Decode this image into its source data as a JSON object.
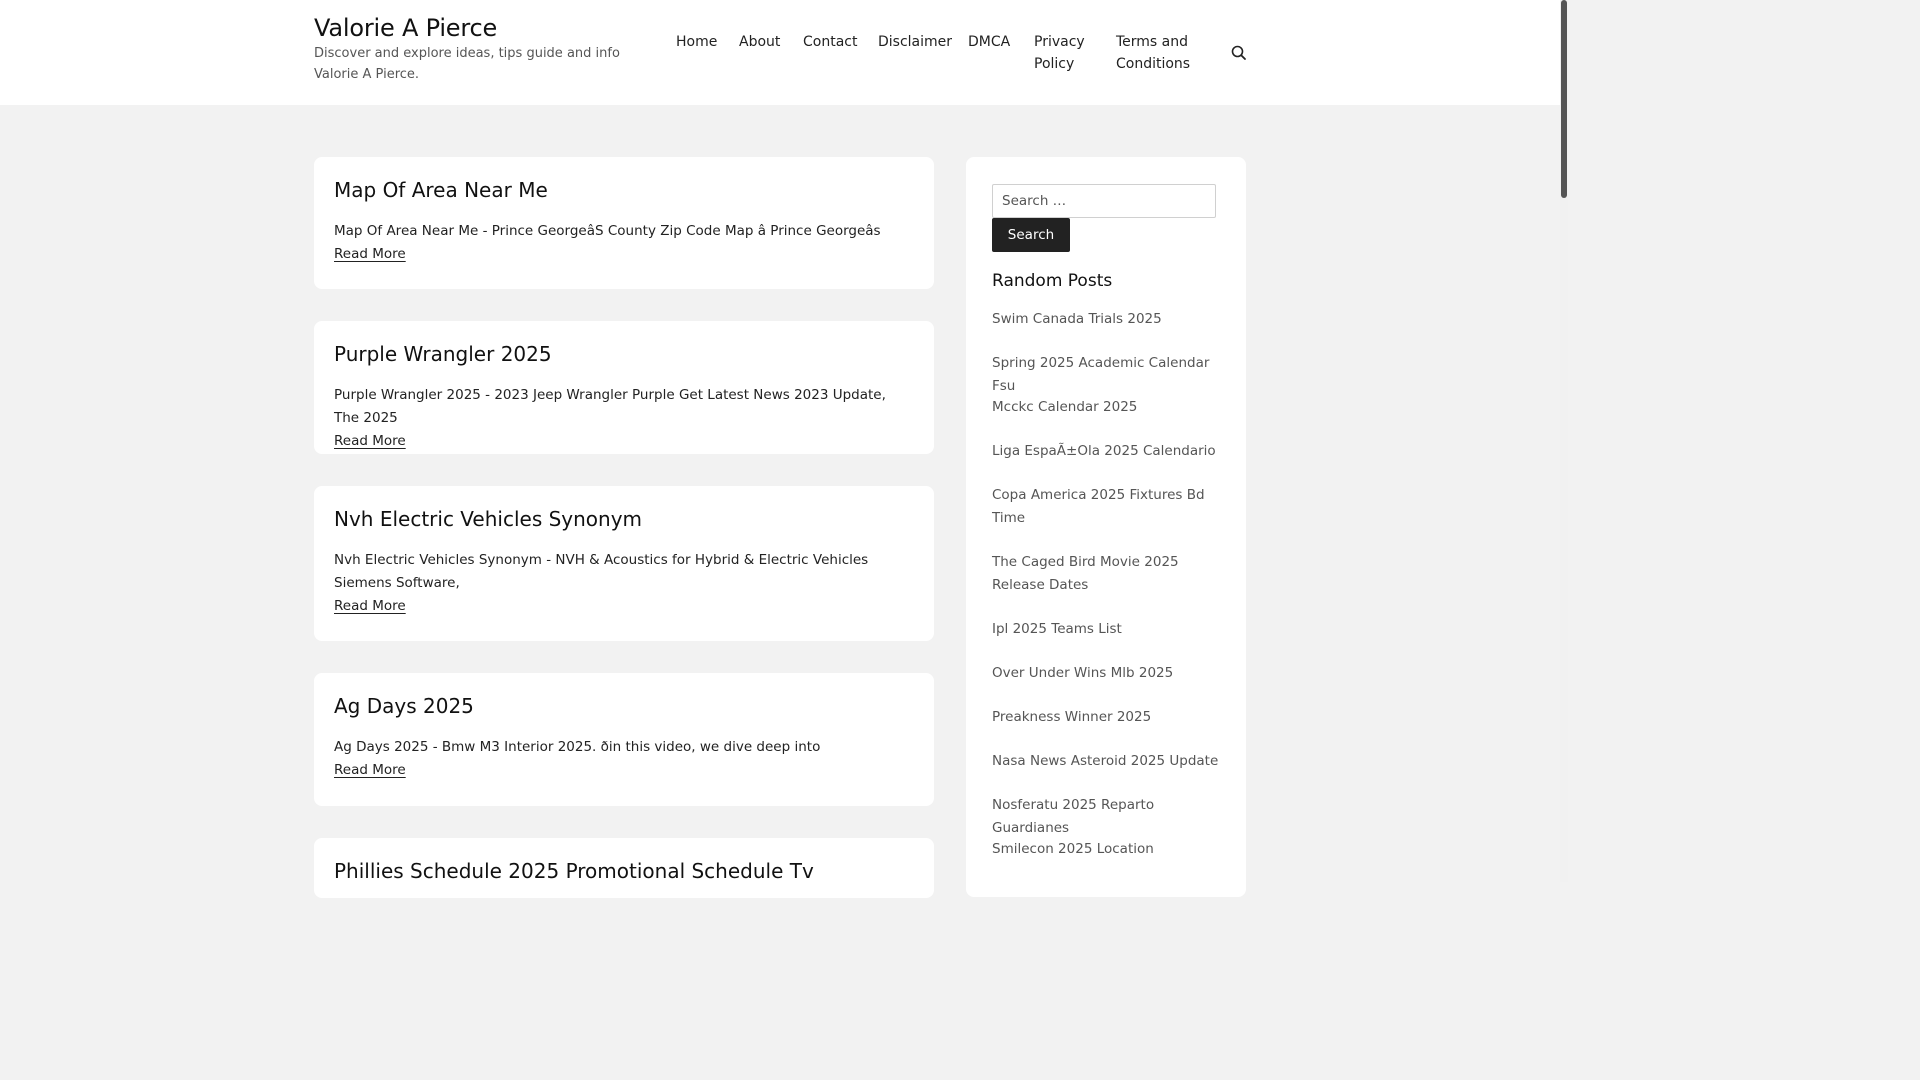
{
  "site": {
    "title": "Valorie A Pierce",
    "description": "Discover and explore ideas, tips guide and info Valorie A Pierce."
  },
  "nav": {
    "items": [
      "Home",
      "About",
      "Contact",
      "Disclaimer",
      "DMCA",
      "Privacy Policy",
      "Terms and Conditions"
    ],
    "search_icon": "search-icon"
  },
  "posts": [
    {
      "title": "Map Of Area Near Me",
      "excerpt": "Map Of Area Near Me - Prince GeorgeâS County Zip Code Map â Prince Georgeâs",
      "read_more": "Read More"
    },
    {
      "title": "Purple Wrangler 2025",
      "excerpt": "Purple Wrangler 2025 - 2023 Jeep Wrangler Purple Get Latest News 2023 Update, The 2025",
      "read_more": "Read More"
    },
    {
      "title": "Nvh Electric Vehicles Synonym",
      "excerpt": "Nvh Electric Vehicles Synonym - NVH & Acoustics for Hybrid & Electric Vehicles Siemens Software,",
      "read_more": "Read More"
    },
    {
      "title": "Ag Days 2025",
      "excerpt": "Ag Days 2025 - Bmw M3 Interior 2025. ðin this video, we dive deep into",
      "read_more": "Read More"
    },
    {
      "title": "Phillies Schedule 2025 Promotional Schedule Tv",
      "excerpt": "",
      "read_more": ""
    }
  ],
  "sidebar": {
    "search": {
      "placeholder": "Search …",
      "button_label": "Search"
    },
    "random_posts": {
      "title": "Random Posts",
      "items": [
        "Swim Canada Trials 2025",
        "Spring 2025 Academic Calendar Fsu",
        "Mcckc Calendar 2025",
        "Liga EspaÃ±Ola 2025 Calendario",
        "Copa America 2025 Fixtures Bd Time",
        "The Caged Bird Movie 2025 Release Dates",
        "Ipl 2025 Teams List",
        "Over Under Wins Mlb 2025",
        "Preakness Winner 2025",
        "Nasa News Asteroid 2025 Update",
        "Nosferatu 2025 Reparto Guardianes",
        "Smilecon 2025 Location"
      ]
    }
  }
}
